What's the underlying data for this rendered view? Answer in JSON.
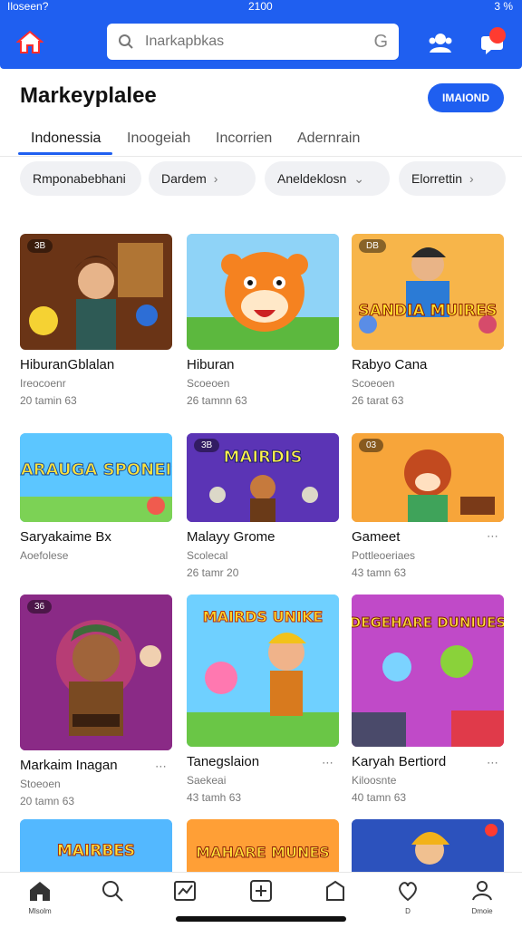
{
  "status": {
    "carrier": "Iloseen?",
    "time": "2100",
    "right": "3 %"
  },
  "search": {
    "placeholder": "Inarkapbkas",
    "value": "Inarkapbkas"
  },
  "header": {
    "title": "Markeyplalee",
    "action_label": "IMAIOND"
  },
  "tabs": [
    {
      "label": "Indonessia"
    },
    {
      "label": "Inoogeiah"
    },
    {
      "label": "Incorrien"
    },
    {
      "label": "Adernrain"
    }
  ],
  "chips": [
    {
      "label": "Rmponabebhani"
    },
    {
      "label": "Dardem"
    },
    {
      "label": "Aneldeklosn"
    },
    {
      "label": "Elorrettin"
    }
  ],
  "cards": [
    {
      "tag": "3B",
      "title": "HiburanGblalan",
      "sub": "Ireocoenr",
      "meta": "20 tamin 63"
    },
    {
      "tag": "",
      "title": "Hiburan",
      "sub": "Scoeoen",
      "meta": "26 tamnn 63"
    },
    {
      "tag": "DB",
      "title": "Rabyo Cana",
      "sub": "Scoeoen",
      "meta": "26 tarat 63"
    },
    {
      "tag": "",
      "title": "Saryakaime Bx",
      "sub": "Aoefolese",
      "meta": ""
    },
    {
      "tag": "3B",
      "title": "Malayy Grome",
      "sub": "Scolecal",
      "meta": "26 tamr 20"
    },
    {
      "tag": "03",
      "title": "Gameet",
      "sub": "Pottleoeriaes",
      "meta": "43 tamn 63"
    },
    {
      "tag": "36",
      "title": "Markaim Inagan",
      "sub": "Stoeoen",
      "meta": "20 tamn 63"
    },
    {
      "tag": "",
      "title": "Tanegslaion",
      "sub": "Saekeai",
      "meta": "43 tamh 63"
    },
    {
      "tag": "",
      "title": "Karyah Bertiord",
      "sub": "Kiloosnte",
      "meta": "40 tamn 63"
    },
    {
      "tag": "",
      "title": "",
      "sub": "",
      "meta": ""
    },
    {
      "tag": "",
      "title": "",
      "sub": "",
      "meta": ""
    },
    {
      "tag": "",
      "title": "",
      "sub": "",
      "meta": ""
    }
  ],
  "card_art_text": [
    "",
    "",
    "SANDIA MUIRES",
    "SARAUGA SPONEIS",
    "MAIRDIS",
    "",
    "",
    "MAIRDS UNIKE",
    "DEGEHARE DUNIUES",
    "MAIRBES",
    "MAHARE MUNES",
    ""
  ],
  "nav": [
    {
      "label": "Mlsolm",
      "icon": "home-icon"
    },
    {
      "label": "",
      "icon": "search-icon"
    },
    {
      "label": "",
      "icon": "chart-icon"
    },
    {
      "label": "",
      "icon": "add-icon"
    },
    {
      "label": "",
      "icon": "bag-icon"
    },
    {
      "label": "D",
      "icon": "heart-icon"
    },
    {
      "label": "Dmoie",
      "icon": "profile-icon"
    }
  ],
  "colors": {
    "primary": "#1f5ff0",
    "badge": "#ff3b30"
  }
}
